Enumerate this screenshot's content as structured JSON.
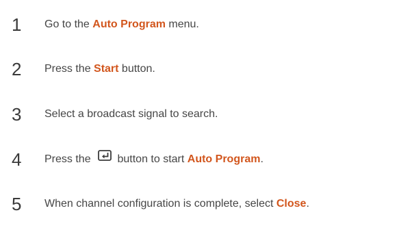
{
  "steps": [
    {
      "number": "1",
      "before": "Go to the ",
      "highlight": "Auto Program",
      "after": " menu."
    },
    {
      "number": "2",
      "before": "Press the ",
      "highlight": "Start",
      "after": " button."
    },
    {
      "number": "3",
      "text": "Select a broadcast signal to search."
    },
    {
      "number": "4",
      "before": "Press the ",
      "icon": "enter-button-icon",
      "middle": " button to start ",
      "highlight": "Auto Program",
      "after": "."
    },
    {
      "number": "5",
      "before": "When channel configuration is complete, select ",
      "highlight": "Close",
      "after": "."
    }
  ],
  "colors": {
    "highlight": "#d2561d",
    "text": "#454545",
    "number": "#3a3a3a"
  }
}
